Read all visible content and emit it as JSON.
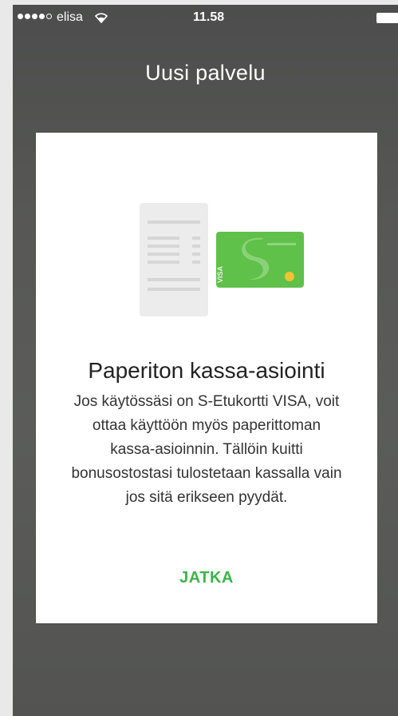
{
  "status_bar": {
    "signal_dots": [
      true,
      true,
      true,
      true,
      false
    ],
    "carrier": "elisa",
    "wifi_icon": "wifi-icon",
    "time": "11.58",
    "battery_icon": "battery-icon"
  },
  "header": {
    "title": "Uusi palvelu"
  },
  "card": {
    "illustration": {
      "receipt_icon": "receipt-icon",
      "card_icon": "s-etukortti-visa-card-icon",
      "card_brand": "VISA",
      "card_color": "#5fc04a"
    },
    "title": "Paperiton kassa-asiointi",
    "body_lines": [
      "Jos käytössäsi on S-Etukortti VISA, voit",
      "ottaa käyttöön myös paperittoman",
      "kassa-asioinnin. Tällöin kuitti",
      "bonusostostasi tulostetaan kassalla vain",
      "jos sitä erikseen pyydät."
    ],
    "continue_label": "JATKA"
  },
  "colors": {
    "accent": "#3bb44a",
    "background": "#555654",
    "card": "#ffffff"
  }
}
